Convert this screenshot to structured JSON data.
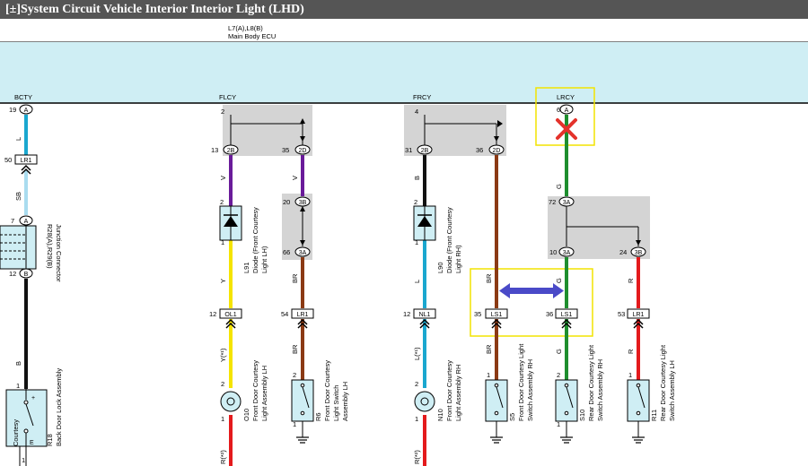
{
  "title": {
    "toggle": "[±]",
    "text": "System Circuit  Vehicle Interior  Interior Light (LHD)"
  },
  "ecu": {
    "code": "L7(A),L8(B)",
    "name": "Main Body ECU"
  },
  "terminals": {
    "bcty": "BCTY",
    "flcy": "FLCY",
    "frcy": "FRCY",
    "lrcy": "LRCY"
  },
  "pins": {
    "p19": "19",
    "pA1": "A",
    "p2a": "2",
    "p4": "4",
    "p6": "6",
    "pA2": "A",
    "p13": "13",
    "p2B1": "2B",
    "p35a": "35",
    "p2D1": "2D",
    "p31": "31",
    "p2B2": "2B",
    "p36a": "36",
    "p2D2": "2D",
    "p72": "72",
    "p3A1": "3A",
    "p20": "20",
    "p3B1": "3B",
    "p66": "66",
    "p3A2": "3A",
    "p10": "10",
    "p3A3": "3A",
    "p24": "24",
    "p3B2": "3B",
    "p50": "50",
    "p7": "7",
    "pA3": "A",
    "p12a": "12",
    "pB1": "B",
    "p12b": "12",
    "p54": "54",
    "p12c": "12",
    "p35b": "35",
    "p36b": "36",
    "p53": "53",
    "p2b": "2",
    "p1a": "1",
    "p2c": "2",
    "p1b": "1",
    "p2d": "2",
    "p1c": "1",
    "p2e": "2",
    "p1d": "1",
    "p2f": "2",
    "p1e": "1",
    "p2g": "2",
    "p1f": "1",
    "p1g": "1",
    "p1h": "1",
    "p1i": "1",
    "p1j": "1"
  },
  "connectors": {
    "lr1a": "LR1",
    "ol1": "OL1",
    "lr1b": "LR1",
    "nl1": "NL1",
    "ls1a": "LS1",
    "ls1b": "LS1",
    "lr1c": "LR1"
  },
  "wire_colors": {
    "l1": "L",
    "sb": "SB",
    "b1": "B",
    "v1": "V",
    "v2": "V",
    "y": "Y",
    "y_star": "Y(*¹)",
    "r_star1": "R(*²)",
    "br1": "BR",
    "br2": "BR",
    "b2": "B",
    "l2": "L",
    "l_star": "L(*¹)",
    "r_star2": "R(*²)",
    "br3": "BR",
    "br4": "BR",
    "g1": "G",
    "g2": "G",
    "g3": "G",
    "r1": "R",
    "r2": "R"
  },
  "colors": {
    "ecu_fill": "#cfeef4",
    "wire_blue": "#1aa7cf",
    "wire_lightblue": "#a9dcef",
    "wire_black": "#111111",
    "wire_violet": "#6a1b9a",
    "wire_yellow": "#f5e400",
    "wire_brown": "#8b3a14",
    "wire_green": "#1e8e2e",
    "wire_red": "#e41a1c",
    "highlight_box": "#f2e300",
    "marker_x": "#e4322b",
    "arrow": "#4a4ac8",
    "splice_gray": "#d4d4d4"
  },
  "components": {
    "r18": {
      "id": "R18",
      "name": "Back Door Lock Assembly",
      "switch_label": "Courtesy",
      "plus": "+",
      "e": "E"
    },
    "r28": {
      "id": "R28(A),R29(B)",
      "name": "Junction Connector"
    },
    "l91": {
      "id": "L91",
      "name": "Diode (Front Courtesy Light LH)"
    },
    "l90": {
      "id": "L90",
      "name": "Diode (Front Courtesy Light RH)"
    },
    "o10": {
      "id": "O10",
      "name": "Front Door Courtesy Light Assembly LH"
    },
    "n10": {
      "id": "N10",
      "name": "Front Door Courtesy Light Assembly RH"
    },
    "r6": {
      "id": "R6",
      "name": "Front Door Courtesy Light Switch Assembly LH"
    },
    "s5": {
      "id": "S5",
      "name": "Front Door Courtesy Light Switch Assembly RH"
    },
    "s10": {
      "id": "S10",
      "name": "Rear Door Courtesy Light Switch Assembly RH"
    },
    "r11": {
      "id": "R11",
      "name": "Rear Door Courtesy Light Switch Assembly LH"
    }
  }
}
